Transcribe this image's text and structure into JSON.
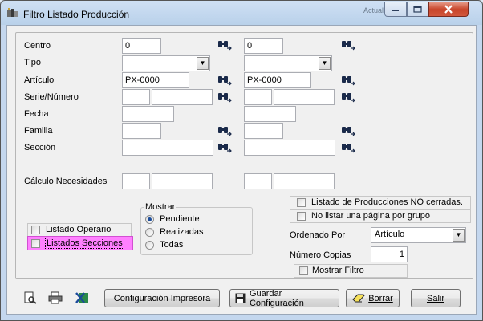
{
  "window": {
    "title": "Filtro Listado Producción",
    "background_text": "Actualizaci..."
  },
  "filters": {
    "centro": {
      "label": "Centro",
      "from": "0",
      "to": "0"
    },
    "tipo": {
      "label": "Tipo",
      "from": "",
      "to": ""
    },
    "articulo": {
      "label": "Artículo",
      "from": "PX-0000",
      "to": "PX-0000"
    },
    "serie": {
      "label": "Serie/Número",
      "from_serie": "",
      "from_num": "",
      "to_serie": "",
      "to_num": ""
    },
    "fecha": {
      "label": "Fecha",
      "from": "",
      "to": ""
    },
    "familia": {
      "label": "Familia",
      "from": "",
      "to": ""
    },
    "seccion": {
      "label": "Sección",
      "from": "",
      "to": ""
    },
    "calculo": {
      "label": "Cálculo Necesidades",
      "from_a": "",
      "from_b": "",
      "to_a": "",
      "to_b": ""
    }
  },
  "mostrar": {
    "label": "Mostrar",
    "options": [
      {
        "label": "Pendiente",
        "selected": true
      },
      {
        "label": "Realizadas",
        "selected": false
      },
      {
        "label": "Todas",
        "selected": false
      }
    ]
  },
  "checks": {
    "listado_operario": "Listado Operario",
    "listados_secciones": "Listados Secciones",
    "no_cerradas": "Listado de Producciones NO cerradas.",
    "no_listar_pagina": "No listar una página por grupo",
    "mostrar_filtro": "Mostrar Filtro"
  },
  "ordenado": {
    "label": "Ordenado Por",
    "value": "Artículo"
  },
  "copias": {
    "label": "Número Copias",
    "value": "1"
  },
  "buttons": {
    "config_impresora": "Configuración Impresora",
    "guardar_config": "Guardar Configuración",
    "borrar": "Borrar",
    "salir": "Salir"
  },
  "colors": {
    "highlight": "#ff80ff",
    "radio_dot": "#1c4d9a",
    "close_button": "#c8452a"
  }
}
